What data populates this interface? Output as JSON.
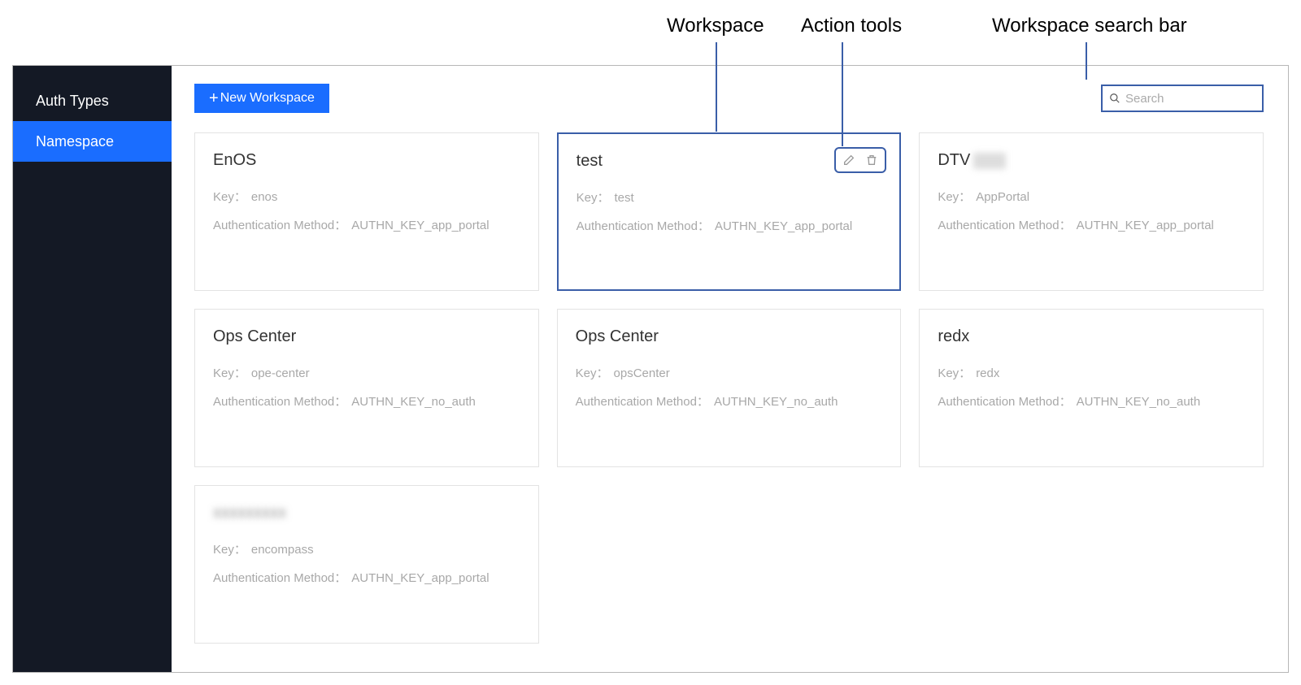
{
  "annotations": {
    "workspace": "Workspace",
    "action_tools": "Action tools",
    "search_bar": "Workspace search bar"
  },
  "sidebar": {
    "items": [
      {
        "label": "Auth Types",
        "active": false
      },
      {
        "label": "Namespace",
        "active": true
      }
    ]
  },
  "toolbar": {
    "new_workspace_label": "New Workspace"
  },
  "search": {
    "placeholder": "Search",
    "value": ""
  },
  "labels": {
    "key": "Key：",
    "auth_method": "Authentication Method："
  },
  "cards": [
    {
      "title": "EnOS",
      "key": "enos",
      "auth_method": "AUTHN_KEY_app_portal",
      "highlight": false,
      "show_tools": false,
      "blurred": false,
      "title_extra_blur": false
    },
    {
      "title": "test",
      "key": "test",
      "auth_method": "AUTHN_KEY_app_portal",
      "highlight": true,
      "show_tools": true,
      "blurred": false,
      "title_extra_blur": false
    },
    {
      "title": "DTV",
      "key": "AppPortal",
      "auth_method": "AUTHN_KEY_app_portal",
      "highlight": false,
      "show_tools": false,
      "blurred": false,
      "title_extra_blur": true
    },
    {
      "title": "Ops Center",
      "key": "ope-center",
      "auth_method": "AUTHN_KEY_no_auth",
      "highlight": false,
      "show_tools": false,
      "blurred": false,
      "title_extra_blur": false
    },
    {
      "title": "Ops Center",
      "key": "opsCenter",
      "auth_method": "AUTHN_KEY_no_auth",
      "highlight": false,
      "show_tools": false,
      "blurred": false,
      "title_extra_blur": false
    },
    {
      "title": "redx",
      "key": "redx",
      "auth_method": "AUTHN_KEY_no_auth",
      "highlight": false,
      "show_tools": false,
      "blurred": false,
      "title_extra_blur": false
    },
    {
      "title": "xxxxxxxxx",
      "key": "encompass",
      "auth_method": "AUTHN_KEY_app_portal",
      "highlight": false,
      "show_tools": false,
      "blurred": true,
      "title_extra_blur": false
    }
  ]
}
